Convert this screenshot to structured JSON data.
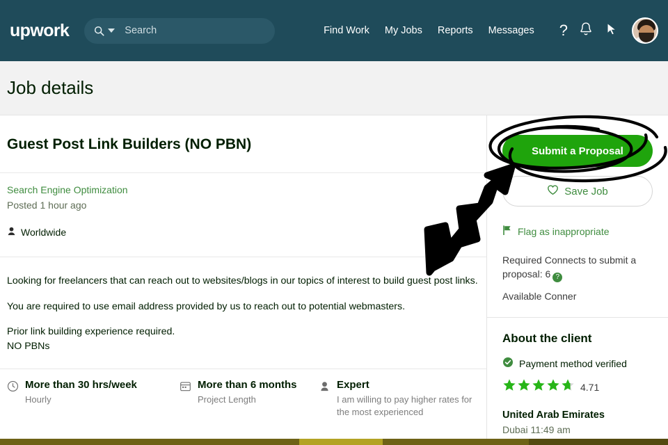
{
  "brand": {
    "logo_text": "upwork",
    "header_bg": "#1f4b5a",
    "green": "#1fa40c",
    "link_green": "#3f8c3f"
  },
  "nav": {
    "search": {
      "placeholder": "Search",
      "icon": "search-icon",
      "dropdown_icon": "chevron-down-icon"
    },
    "links": [
      {
        "label": "Find Work"
      },
      {
        "label": "My Jobs"
      },
      {
        "label": "Reports"
      },
      {
        "label": "Messages"
      }
    ],
    "icons": [
      {
        "name": "help-icon",
        "glyph": "?"
      },
      {
        "name": "notifications-bell-icon"
      },
      {
        "name": "mouse-cursor-icon"
      },
      {
        "name": "avatar"
      }
    ]
  },
  "page": {
    "title": "Job details"
  },
  "job": {
    "title": "Guest Post Link Builders (NO PBN)",
    "category": "Search Engine Optimization",
    "posted": "Posted 1 hour ago",
    "location": "Worldwide",
    "description": [
      "Looking for freelancers that can reach out to websites/blogs in our topics of interest to build guest post links.",
      "You are required to use email address provided by us to reach out to potential webmasters.",
      "Prior link building experience required.",
      "NO PBNs"
    ],
    "attributes": [
      {
        "icon": "clock-icon",
        "main": "More than 30 hrs/week",
        "sub": "Hourly"
      },
      {
        "icon": "calendar-icon",
        "main": "More than 6 months",
        "sub": "Project Length"
      },
      {
        "icon": "expertise-icon",
        "main": "Expert",
        "sub": "I am willing to pay higher rates for the most experienced"
      }
    ]
  },
  "sidebar": {
    "submit_label": "Submit a Proposal",
    "save_label": "Save Job",
    "save_icon": "heart-icon",
    "flag_label": "Flag as inappropriate",
    "flag_icon": "flag-icon",
    "connects_text": "Required Connects to submit a proposal: 6",
    "connects_help_glyph": "?",
    "available_text": "Available Conner",
    "client": {
      "heading": "About the client",
      "payment_verified": "Payment method verified",
      "payment_icon": "verified-check-icon",
      "rating": "4.71",
      "stars_filled": 4.7,
      "country": "United Arab Emirates",
      "city_time": "Dubai 11:49 am"
    }
  },
  "annotations": {
    "circle_target": "Submit a Proposal",
    "arrow": "arrow-pointing-to-submit-proposal"
  }
}
